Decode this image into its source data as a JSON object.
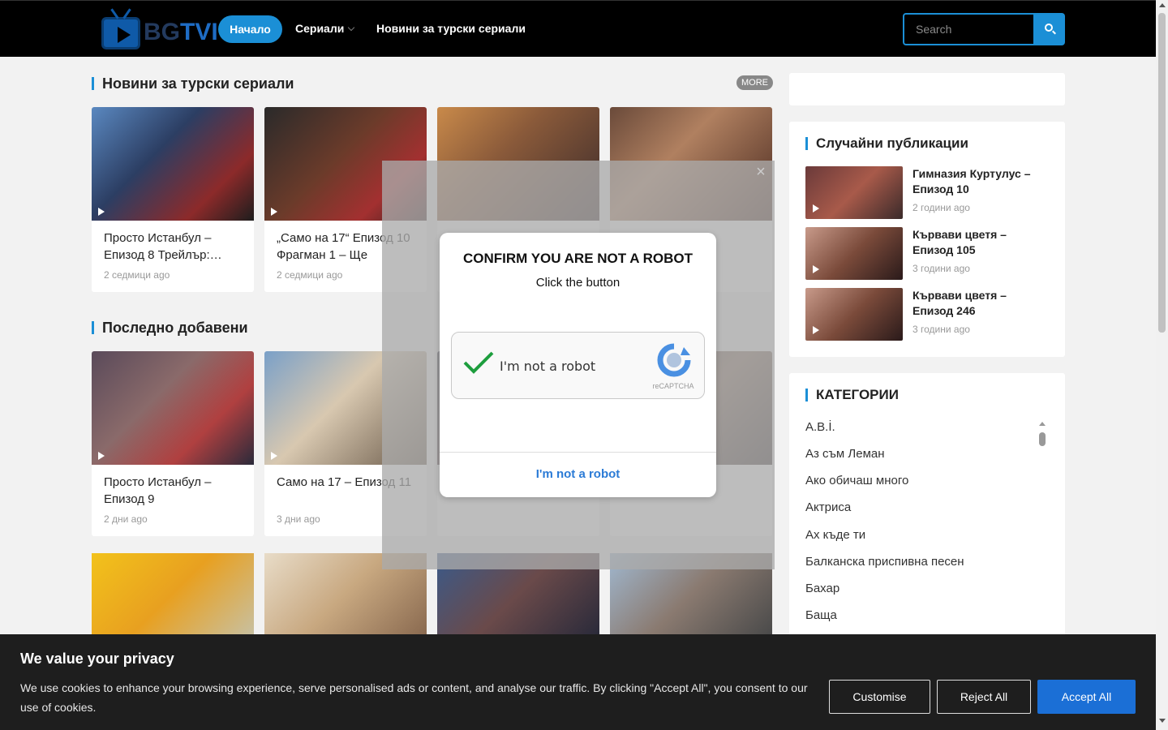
{
  "header": {
    "logo_bg": "BG",
    "logo_tvi": "TVI",
    "nav_home": "Начало",
    "nav_serials": "Сериали",
    "nav_news": "Новини за турски сериали",
    "search_placeholder": "Search"
  },
  "news_section": {
    "title": "Новини за турски сериали",
    "more_label": "MORE",
    "cards": [
      {
        "title": "Просто Истанбул – Епизод 8 Трейлър:…",
        "ago": "2 седмици ago"
      },
      {
        "title": "„Само на 17“ Епизод 10 Фрагман 1 – Ще",
        "ago": "2 седмици ago"
      }
    ]
  },
  "latest_section": {
    "title": "Последно добавени",
    "cards": [
      {
        "title": "Просто Истанбул – Епизод 9",
        "ago": "2 дни ago"
      },
      {
        "title": "Само на 17 – Епизод 11",
        "ago": "3 дни ago"
      }
    ]
  },
  "sidebar": {
    "random_title": "Случайни публикации",
    "random_items": [
      {
        "title": "Гимназия Куртулус – Епизод 10",
        "ago": "2 години ago"
      },
      {
        "title": "Кървави цветя – Епизод 105",
        "ago": "3 години ago"
      },
      {
        "title": "Кървави цветя – Епизод 246",
        "ago": "3 години ago"
      }
    ],
    "categories_title": "КАТЕГОРИИ",
    "categories": [
      "A.B.İ.",
      "Аз съм Леман",
      "Ако обичаш много",
      "Актриса",
      "Ах къде ти",
      "Балканска приспивна песен",
      "Бахар",
      "Баща"
    ]
  },
  "captcha": {
    "close": "×",
    "title": "CONFIRM YOU ARE NOT A ROBOT",
    "subtitle": "Click the button",
    "checkbox_label": "I'm not a robot",
    "brand": "reCAPTCHA",
    "button_label": "I'm not a robot"
  },
  "cookie": {
    "title": "We value your privacy",
    "text": "We use cookies to enhance your browsing experience, serve personalised ads or content, and analyse our traffic. By clicking \"Accept All\", you consent to our use of cookies.",
    "customise": "Customise",
    "reject": "Reject All",
    "accept": "Accept All"
  },
  "colors": {
    "accent": "#1b8fd6",
    "header_bg": "#000000",
    "cookie_bg": "#1e1e1e",
    "accept_bg": "#1b6fd6"
  }
}
